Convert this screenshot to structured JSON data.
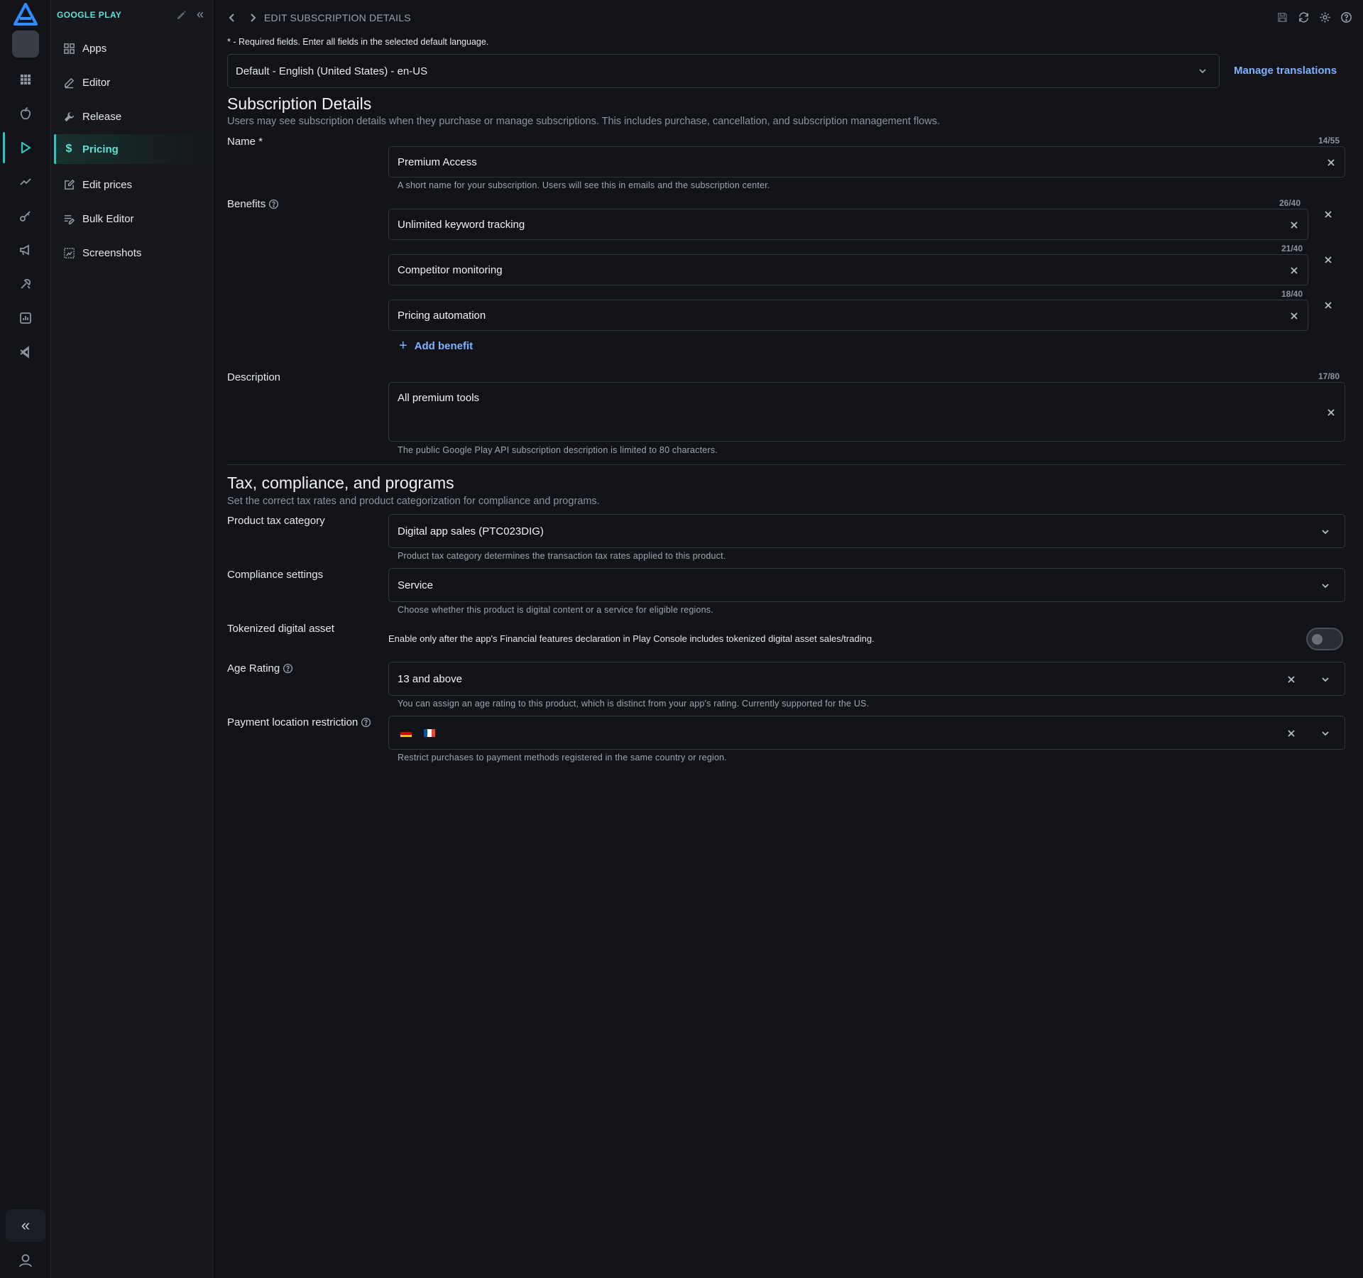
{
  "rail": {
    "items": [
      {
        "icon": "grid-icon"
      },
      {
        "icon": "apple-icon"
      },
      {
        "icon": "google-play-icon",
        "active": true
      },
      {
        "icon": "trend-icon"
      },
      {
        "icon": "key-icon"
      },
      {
        "icon": "megaphone-icon"
      },
      {
        "icon": "tools-icon"
      },
      {
        "icon": "analytics-icon"
      },
      {
        "icon": "vscode-icon"
      }
    ],
    "collapse_glyph": "«"
  },
  "sidebar": {
    "title": "GOOGLE PLAY",
    "collapse_glyph": "«",
    "items": [
      {
        "label": "Apps",
        "icon": "apps-grid-icon"
      },
      {
        "label": "Editor",
        "icon": "pencil-icon"
      },
      {
        "label": "Release",
        "icon": "wrench-icon"
      },
      {
        "label": "Pricing",
        "icon": "dollar-icon",
        "active": true
      },
      {
        "label": "Edit prices",
        "icon": "edit-square-icon"
      },
      {
        "label": "Bulk Editor",
        "icon": "bulk-edit-icon"
      },
      {
        "label": "Screenshots",
        "icon": "screenshot-icon"
      }
    ]
  },
  "header": {
    "title": "EDIT SUBSCRIPTION DETAILS",
    "icons": [
      "save-icon",
      "sync-icon",
      "settings-icon",
      "help-icon"
    ]
  },
  "form": {
    "required_note": "* - Required fields. Enter all fields in the selected default language.",
    "language": "Default - English (United States) - en-US",
    "manage_translations": "Manage translations",
    "subscription": {
      "title": "Subscription Details",
      "desc": "Users may see subscription details when they purchase or manage subscriptions. This includes purchase, cancellation, and subscription management flows.",
      "name_label": "Name *",
      "name_value": "Premium Access",
      "name_counter": "14/55",
      "name_hint": "A short name for your subscription. Users will see this in emails and the subscription center.",
      "benefits_label": "Benefits",
      "benefits": [
        {
          "value": "Unlimited keyword tracking",
          "counter": "26/40"
        },
        {
          "value": "Competitor monitoring",
          "counter": "21/40"
        },
        {
          "value": "Pricing automation",
          "counter": "18/40"
        }
      ],
      "add_benefit": "Add benefit",
      "description_label": "Description",
      "description_value": "All premium tools",
      "description_counter": "17/80",
      "description_hint": "The public Google Play API subscription description is limited to 80 characters."
    },
    "tax": {
      "title": "Tax, compliance, and programs",
      "desc": "Set the correct tax rates and product categorization for compliance and programs.",
      "tax_category_label": "Product tax category",
      "tax_category_value": "Digital app sales (PTC023DIG)",
      "tax_category_hint": "Product tax category determines the transaction tax rates applied to this product.",
      "compliance_label": "Compliance settings",
      "compliance_value": "Service",
      "compliance_hint": "Choose whether this product is digital content or a service for eligible regions.",
      "tokenized_label": "Tokenized digital asset",
      "tokenized_text": "Enable only after the app's Financial features declaration in Play Console includes tokenized digital asset sales/trading.",
      "tokenized_enabled": false,
      "age_label": "Age Rating",
      "age_value": "13 and above",
      "age_hint": "You can assign an age rating to this product, which is distinct from your app's rating. Currently supported for the US.",
      "payment_label": "Payment location restriction",
      "payment_flags": [
        "flag-germany-icon",
        "flag-france-icon"
      ],
      "payment_hint": "Restrict purchases to payment methods registered in the same country or region."
    }
  },
  "colors": {
    "accent": "#2ec4b6",
    "link": "#7fb2ff",
    "background": "#111318"
  }
}
